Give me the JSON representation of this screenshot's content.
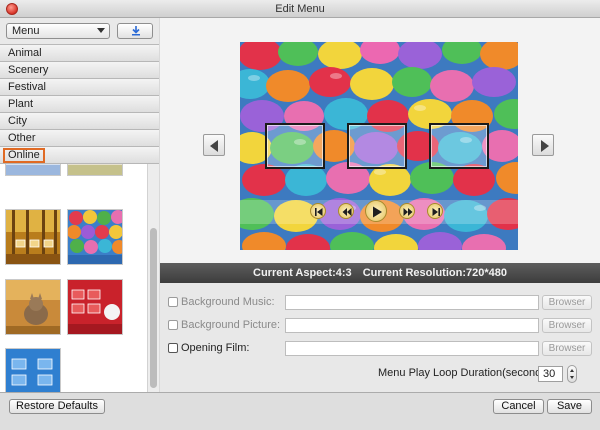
{
  "window": {
    "title": "Edit Menu"
  },
  "sidebar": {
    "menu_select": "Menu",
    "download_icon": "download-icon",
    "categories": [
      "Animal",
      "Scenery",
      "Festival",
      "Plant",
      "City",
      "Other",
      "Online"
    ],
    "selected_category": "Online",
    "thumbnails": [
      "autumn-forest-template",
      "colorful-balls-template",
      "cat-template",
      "red-festive-template",
      "blue-frames-template"
    ]
  },
  "preview": {
    "prev_icon": "chevron-left-icon",
    "next_icon": "chevron-right-icon",
    "controls": [
      "skip-back-icon",
      "rewind-icon",
      "play-icon",
      "fast-forward-icon",
      "skip-forward-icon"
    ]
  },
  "info": {
    "aspect": "Current Aspect:4:3",
    "resolution": "Current Resolution:720*480"
  },
  "settings": {
    "background_music": {
      "label": "Background Music:",
      "value": "",
      "browse": "Browser"
    },
    "background_picture": {
      "label": "Background Picture:",
      "value": "",
      "browse": "Browser"
    },
    "opening_film": {
      "label": "Opening Film:",
      "value": "",
      "browse": "Browser"
    },
    "loop_label": "Menu Play Loop Duration(seconds):",
    "loop_value": "30"
  },
  "footer": {
    "restore": "Restore Defaults",
    "cancel": "Cancel",
    "save": "Save"
  },
  "colors": {
    "selected_outline": "#e06a24",
    "info_bar": "#4a4a4a"
  }
}
